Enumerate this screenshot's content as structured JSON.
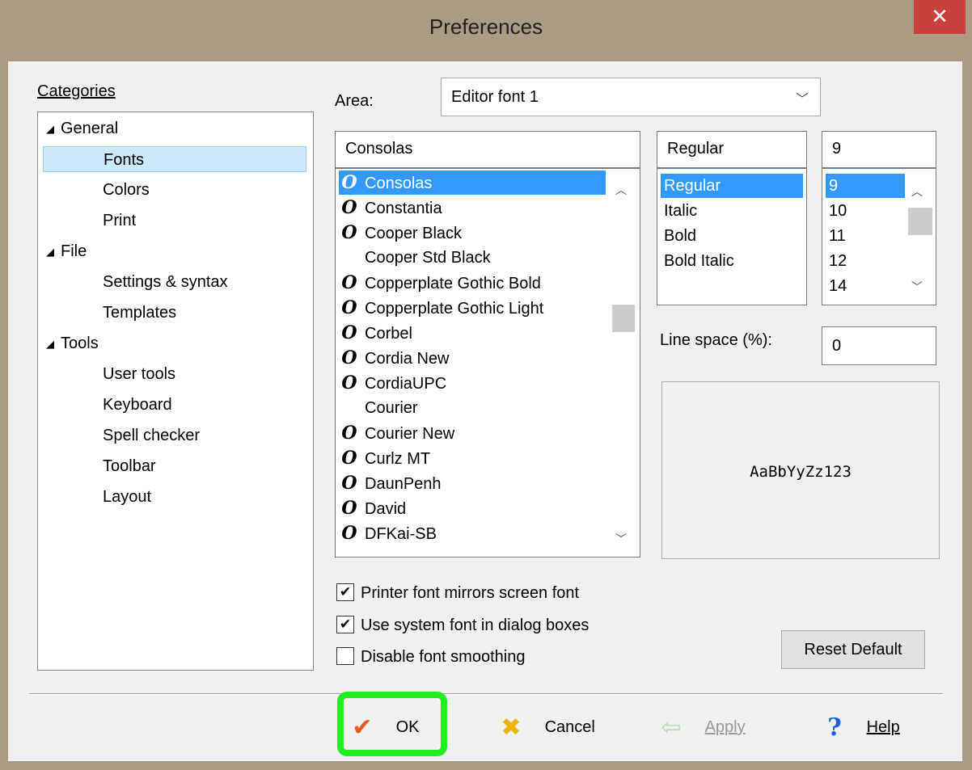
{
  "window": {
    "title": "Preferences",
    "close_glyph": "✕"
  },
  "categories": {
    "label": "Categories",
    "items": [
      {
        "label": "General",
        "expanded": true
      },
      {
        "label": "Fonts",
        "selected": true
      },
      {
        "label": "Colors"
      },
      {
        "label": "Print"
      },
      {
        "label": "File",
        "expanded": true
      },
      {
        "label": "Settings & syntax"
      },
      {
        "label": "Templates"
      },
      {
        "label": "Tools",
        "expanded": true
      },
      {
        "label": "User tools"
      },
      {
        "label": "Keyboard"
      },
      {
        "label": "Spell checker"
      },
      {
        "label": "Toolbar"
      },
      {
        "label": "Layout"
      }
    ]
  },
  "area": {
    "label": "Area:",
    "value": "Editor font 1"
  },
  "font": {
    "value": "Consolas",
    "list": [
      "Consolas",
      "Constantia",
      "Cooper Black",
      "Cooper Std Black",
      "Copperplate Gothic Bold",
      "Copperplate Gothic Light",
      "Corbel",
      "Cordia New",
      "CordiaUPC",
      "Courier",
      "Courier New",
      "Curlz MT",
      "DaunPenh",
      "David",
      "DFKai-SB"
    ],
    "no_truetype_icon": [
      "Cooper Std Black",
      "Courier"
    ],
    "selected": "Consolas"
  },
  "style": {
    "value": "Regular",
    "list": [
      "Regular",
      "Italic",
      "Bold",
      "Bold Italic"
    ],
    "selected": "Regular"
  },
  "size": {
    "value": "9",
    "list": [
      "9",
      "10",
      "11",
      "12",
      "14"
    ],
    "selected": "9"
  },
  "line_space": {
    "label": "Line space (%):",
    "value": "0"
  },
  "preview": {
    "text": "AaBbYyZz123"
  },
  "options": [
    {
      "label": "Printer font mirrors screen font",
      "checked": true
    },
    {
      "label": "Use system font in dialog boxes",
      "checked": true
    },
    {
      "label": "Disable font smoothing",
      "checked": false
    }
  ],
  "reset_button": {
    "label": "Reset Default"
  },
  "footer": {
    "ok": {
      "label": "OK"
    },
    "cancel": {
      "label": "Cancel"
    },
    "apply": {
      "label": "Apply",
      "enabled": false
    },
    "help": {
      "label": "Help"
    }
  },
  "colors": {
    "selection": "#3399ff",
    "tree_selection": "#cce8ff",
    "highlight_ring": "#22ee22",
    "close_button": "#c7423b"
  }
}
